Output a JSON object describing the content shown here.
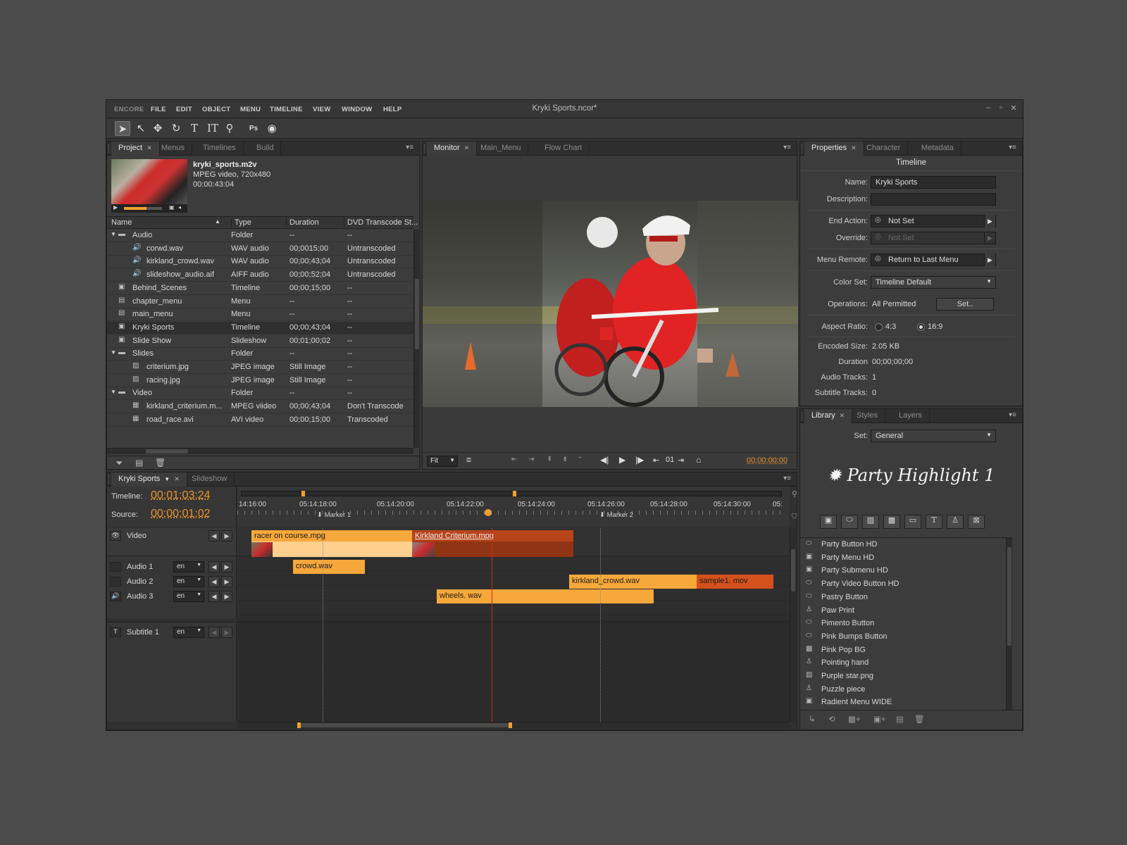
{
  "window": {
    "title": "Kryki Sports.ncor*"
  },
  "menubar": [
    "ENCORE",
    "FILE",
    "EDIT",
    "OBJECT",
    "MENU",
    "TIMELINE",
    "VIEW",
    "WINDOW",
    "HELP"
  ],
  "toolbar": {
    "tools": [
      "selection-arrow",
      "direct-select-arrow",
      "move",
      "rotate",
      "text",
      "vertical-text",
      "zoom",
      "photoshop",
      "preview"
    ]
  },
  "project": {
    "tabs": [
      "Project",
      "Menus",
      "Timelines",
      "Build"
    ],
    "preview": {
      "filename": "kryki_sports.m2v",
      "info": "MPEG video, 720x480",
      "duration": "00:00:43:04"
    },
    "columns": [
      "Name",
      "Type",
      "Duration",
      "DVD Transcode St..."
    ],
    "rows": [
      {
        "name": "Audio",
        "type": "Folder",
        "duration": "--",
        "transcode": "--",
        "indent": 0,
        "kind": "folder",
        "expand": "▼"
      },
      {
        "name": "corwd.wav",
        "type": "WAV audio",
        "duration": "00;0015;00",
        "transcode": "Untranscoded",
        "indent": 1,
        "kind": "audio"
      },
      {
        "name": "kirkland_crowd.wav",
        "type": "WAV audio",
        "duration": "00;00;43;04",
        "transcode": "Untranscoded",
        "indent": 1,
        "kind": "audio"
      },
      {
        "name": "slideshow_audio.aif",
        "type": "AIFF audio",
        "duration": "00;00;52;04",
        "transcode": "Untranscoded",
        "indent": 1,
        "kind": "audio"
      },
      {
        "name": "Behind_Scenes",
        "type": "Timeline",
        "duration": "00;00;15;00",
        "transcode": "--",
        "indent": 0,
        "kind": "timeline"
      },
      {
        "name": "chapter_menu",
        "type": "Menu",
        "duration": "--",
        "transcode": "--",
        "indent": 0,
        "kind": "menu"
      },
      {
        "name": "main_menu",
        "type": "Menu",
        "duration": "--",
        "transcode": "--",
        "indent": 0,
        "kind": "menu"
      },
      {
        "name": "Kryki Sports",
        "type": "Timeline",
        "duration": "00;00;43;04",
        "transcode": "--",
        "indent": 0,
        "kind": "timeline"
      },
      {
        "name": "Slide Show",
        "type": "Slideshow",
        "duration": "00;01;00;02",
        "transcode": "--",
        "indent": 0,
        "kind": "timeline"
      },
      {
        "name": "Slides",
        "type": "Folder",
        "duration": "--",
        "transcode": "--",
        "indent": 0,
        "kind": "folder",
        "expand": "▼"
      },
      {
        "name": "criterium.jpg",
        "type": "JPEG image",
        "duration": "Still Image",
        "transcode": "--",
        "indent": 1,
        "kind": "image"
      },
      {
        "name": "racing.jpg",
        "type": "JPEG image",
        "duration": "Still Image",
        "transcode": "--",
        "indent": 1,
        "kind": "image"
      },
      {
        "name": "Video",
        "type": "Folder",
        "duration": "--",
        "transcode": "--",
        "indent": 0,
        "kind": "folder",
        "expand": "▼"
      },
      {
        "name": "kirkland_criterium.m...",
        "type": "MPEG viideo",
        "duration": "00;00;43;04",
        "transcode": "Don't  Transcode",
        "indent": 1,
        "kind": "video"
      },
      {
        "name": "road_race.avi",
        "type": "AVI video",
        "duration": "00;00;15;00",
        "transcode": "Transcoded",
        "indent": 1,
        "kind": "video"
      }
    ]
  },
  "monitor": {
    "tabs": [
      "Monitor",
      "Main_Menu",
      "Flow Chart"
    ],
    "zoom": "Fit",
    "chapter": "01",
    "timecode": "00;00;00;00"
  },
  "properties": {
    "tabs": [
      "Properties",
      "Character",
      "Metadata"
    ],
    "heading": "Timeline",
    "name_label": "Name:",
    "name": "Kryki Sports",
    "description_label": "Description:",
    "description": "",
    "end_action_label": "End Action:",
    "end_action": "Not Set",
    "override_label": "Override:",
    "override": "Not Set",
    "menu_remote_label": "Menu Remote:",
    "menu_remote": "Return to Last Menu",
    "color_set_label": "Color Set:",
    "color_set": "Timeline Default",
    "operations_label": "Operations:",
    "operations": "All Permitted",
    "set_button": "Set..",
    "aspect_label": "Aspect Ratio:",
    "aspect_4_3": "4:3",
    "aspect_16_9": "16:9",
    "encoded_size_label": "Encoded Size:",
    "encoded_size": "2.05 KB",
    "duration_label": "Duration",
    "duration": "00;00;00;00",
    "audio_tracks_label": "Audio Tracks:",
    "audio_tracks": "1",
    "subtitle_tracks_label": "Subtitle Tracks:",
    "subtitle_tracks": "0"
  },
  "library": {
    "tabs": [
      "Library",
      "Styles",
      "Layers"
    ],
    "set_label": "Set:",
    "set_value": "General",
    "preview_text": "Party Highlight 1",
    "items": [
      {
        "name": "Party Button HD",
        "icon": "button-icon"
      },
      {
        "name": "Party Menu HD",
        "icon": "menu-icon"
      },
      {
        "name": "Party Submenu HD",
        "icon": "menu-icon"
      },
      {
        "name": "Party Video Button HD",
        "icon": "button-icon"
      },
      {
        "name": "Pastry Button",
        "icon": "button-icon"
      },
      {
        "name": "Paw Print",
        "icon": "replaceable-icon"
      },
      {
        "name": "Pimento Button",
        "icon": "button-icon"
      },
      {
        "name": "Pink Bumps Button",
        "icon": "button-icon"
      },
      {
        "name": "Pink Pop BG",
        "icon": "background-icon"
      },
      {
        "name": "Pointing hand",
        "icon": "replaceable-icon"
      },
      {
        "name": "Purple star.png",
        "icon": "image-icon"
      },
      {
        "name": "Puzzle piece",
        "icon": "replaceable-icon"
      },
      {
        "name": "Radient Menu WIDE",
        "icon": "menu-icon"
      }
    ]
  },
  "timeline": {
    "tabs": [
      "Kryki Sports",
      "Slideshow"
    ],
    "timeline_label": "Timeline:",
    "timeline_time": "00;01;03;24",
    "source_label": "Source:",
    "source_time": "00;00;01;02",
    "ruler": [
      "14:16:00",
      "05:14:18:00",
      "05:14:20:00",
      "05:14:22:00",
      "05:14:24:00",
      "05:14:26:00",
      "05:14:28:00",
      "05:14:30:00",
      "05:"
    ],
    "markers": [
      "Marker 1",
      "Marker 2"
    ],
    "tracks": {
      "video": "Video",
      "audio1": "Audio 1",
      "audio2": "Audio 2",
      "audio3": "Audio 3",
      "subtitle1": "Subtitle 1",
      "lang": "en"
    },
    "clips": {
      "video1": "racer on course.mpg",
      "video2": "Kirkland Criterium.mpg",
      "audio1": "crowd.wav",
      "audio2a": "kirkland_crowd.wav",
      "audio2b": "sample1. mov",
      "audio3": "wheels. wav"
    }
  },
  "colors": {
    "accent_orange": "#f7a83a",
    "clip_dark": "#b8441a",
    "playhead": "#d22",
    "bg": "#4b4b4b"
  }
}
